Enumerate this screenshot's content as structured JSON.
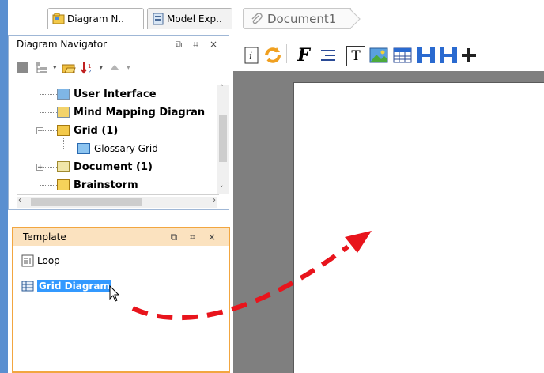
{
  "tabs": {
    "diagram_navigator": "Diagram N..",
    "model_explorer": "Model Exp..",
    "document": "Document1"
  },
  "navigator_panel": {
    "title": "Diagram Navigator",
    "controls": [
      "⧉",
      "⌗",
      "×"
    ],
    "tree": [
      {
        "label": "User Interface",
        "icon": "user-interface-icon"
      },
      {
        "label": "Mind Mapping Diagran",
        "icon": "mind-mapping-icon"
      },
      {
        "label": "Grid (1)",
        "icon": "folder-open-icon",
        "expanded": true
      },
      {
        "label": "Glossary Grid",
        "icon": "grid-icon",
        "child": true
      },
      {
        "label": "Document (1)",
        "icon": "document-icon",
        "expanded": false
      },
      {
        "label": "Brainstorm",
        "icon": "brainstorm-icon"
      }
    ]
  },
  "template_panel": {
    "title": "Template",
    "controls": [
      "⧉",
      "⌗",
      "×"
    ],
    "items": [
      {
        "label": "Loop",
        "icon": "loop-icon"
      },
      {
        "label": "Grid Diagram",
        "icon": "grid-diagram-icon",
        "selected": true
      }
    ]
  },
  "doc_toolbar": {
    "font_label": "F",
    "text_label": "T"
  },
  "colors": {
    "accent_orange": "#f2a640",
    "selection_blue": "#3399ff",
    "arrow_red": "#e8141c",
    "canvas_gray": "#7f7f7f"
  }
}
